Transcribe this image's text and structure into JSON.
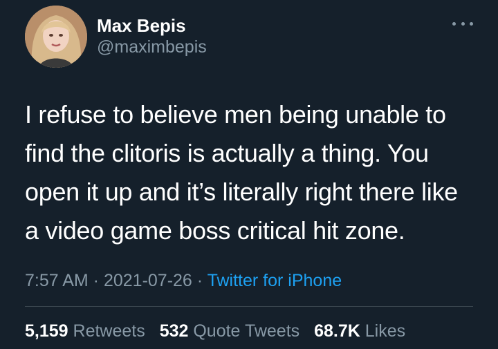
{
  "user": {
    "display_name": "Max Bepis",
    "handle": "@maximbepis"
  },
  "tweet": {
    "text": "I refuse to believe men being unable to\nfind the clitoris is actually a thing. You\nopen it up and it’s literally right there like\na video game boss critical hit zone.",
    "time": "7:57 AM",
    "date": "2021-07-26",
    "source": "Twitter for iPhone",
    "separator": " · "
  },
  "stats": {
    "retweets_count": "5,159",
    "retweets_label": "Retweets",
    "quotes_count": "532",
    "quotes_label": "Quote Tweets",
    "likes_count": "68.7K",
    "likes_label": "Likes"
  },
  "colors": {
    "background": "#15202b",
    "text": "#ffffff",
    "secondary": "#8899a6",
    "link": "#1da1f2",
    "divider": "#38444d"
  },
  "icons": {
    "more": "more-dots-icon"
  }
}
